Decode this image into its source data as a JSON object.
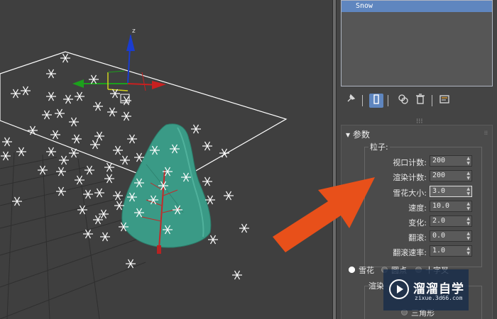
{
  "viewport": {
    "gizmo_axes": [
      "x",
      "y",
      "z"
    ],
    "colors": {
      "snowflake": "#ffffff",
      "emitter": "#ffffff",
      "tree": "#3a9a86",
      "trunk": "#c22a2a",
      "arrow": "#e8501a"
    }
  },
  "modifier_stack": {
    "selected_item": "Snow"
  },
  "toolbar": {
    "pin_icon": "pin-icon",
    "show_end_result_icon": "show-end-result-icon",
    "make_unique_icon": "make-unique-icon",
    "remove_modifier_icon": "trash-icon",
    "configure_icon": "configure-icon"
  },
  "params": {
    "rollout_title": "参数",
    "particles_label": "粒子:",
    "fields": [
      {
        "label": "视口计数:",
        "value": "200"
      },
      {
        "label": "渲染计数:",
        "value": "200"
      },
      {
        "label": "雪花大小:",
        "value": "3.0"
      },
      {
        "label": "速度:",
        "value": "10.0"
      },
      {
        "label": "变化:",
        "value": "2.0"
      },
      {
        "label": "翻滚:",
        "value": "0.0"
      },
      {
        "label": "翻滚速率:",
        "value": "1.0"
      }
    ],
    "flake_types": [
      "雪花",
      "圆点",
      "十字叉"
    ],
    "selected_flake_type": "雪花",
    "render_label": "渲染",
    "render_option_partial": "三角形"
  },
  "watermark": {
    "title": "溜溜自学",
    "url": "zixue.3d66.com"
  }
}
